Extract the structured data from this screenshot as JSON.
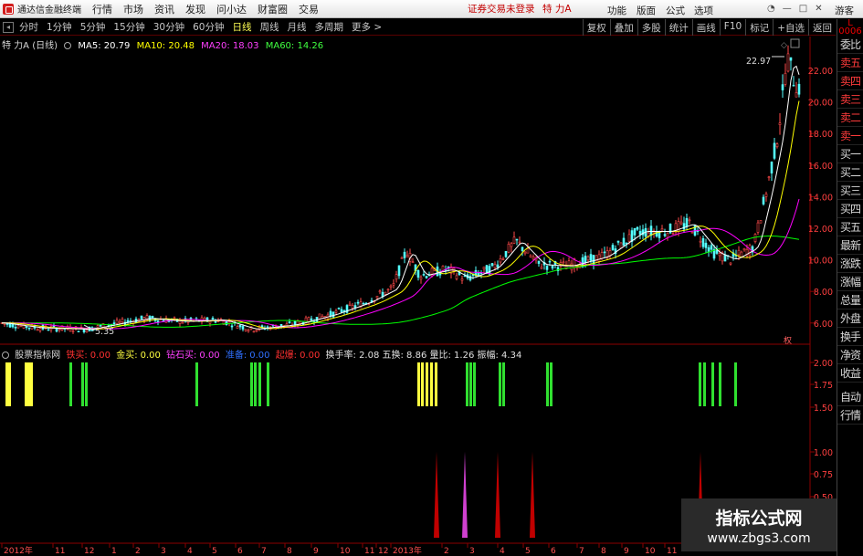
{
  "menubar": {
    "app_title": "通达信金融终端",
    "items": [
      "行情",
      "市场",
      "资讯",
      "发现",
      "问小达",
      "财富圈",
      "交易"
    ],
    "status_text": "证券交易未登录",
    "stock_name": "特 力A",
    "right_buttons": [
      "功能",
      "版面",
      "公式",
      "选项"
    ],
    "guest_label": "游客"
  },
  "toolbar": {
    "periods": [
      "分时",
      "1分钟",
      "5分钟",
      "15分钟",
      "30分钟",
      "60分钟",
      "日线",
      "周线",
      "月线",
      "多周期",
      "更多 >"
    ],
    "active_period": "日线",
    "right_tools": [
      "复权",
      "叠加",
      "多股",
      "统计",
      "画线",
      "F10",
      "标记",
      "+自选",
      "返回"
    ]
  },
  "chart_info": {
    "title": "特 力A (日线)",
    "ma5": "MA5: 20.79",
    "ma10": "MA10: 20.48",
    "ma20": "MA20: 18.03",
    "ma60": "MA60: 14.26"
  },
  "indicator_info": {
    "name": "股票指标网",
    "items": [
      {
        "label": "铁买:",
        "value": "0.00",
        "color": "#ff3030"
      },
      {
        "label": "金买:",
        "value": "0.00",
        "color": "#ffff40"
      },
      {
        "label": "钻石买:",
        "value": "0.00",
        "color": "#ff40ff"
      },
      {
        "label": "准备:",
        "value": "0.00",
        "color": "#3070ff"
      },
      {
        "label": "起爆:",
        "value": "0.00",
        "color": "#ff3030"
      }
    ],
    "stats": "换手率: 2.08  五换: 8.86  量比: 1.26  振幅: 4.34"
  },
  "right_panel": {
    "badge": "L 0006",
    "items": [
      "委比",
      "卖五",
      "卖四",
      "卖三",
      "卖二",
      "卖一",
      "买一",
      "买二",
      "买三",
      "买四",
      "买五",
      "最新",
      "涨跌",
      "涨幅",
      "总量",
      "外盘",
      "换手",
      "净资",
      "收益"
    ],
    "bottom_items": [
      "自动",
      "行情"
    ]
  },
  "price_axis": [
    "22.00",
    "20.00",
    "18.00",
    "16.00",
    "14.00",
    "12.00",
    "10.00",
    "8.00",
    "6.00"
  ],
  "indicator_axis": [
    "2.00",
    "1.75",
    "1.50",
    "1.00",
    "0.75",
    "0.50",
    "0.25"
  ],
  "date_axis": [
    "2012年",
    "11",
    "12",
    "1",
    "2",
    "3",
    "4",
    "5",
    "6",
    "7",
    "8",
    "9",
    "10",
    "11",
    "12",
    "2013年",
    "2",
    "3",
    "4",
    "5",
    "6",
    "7",
    "8",
    "9",
    "10",
    "11"
  ],
  "annotations": {
    "high": "22.97",
    "low": "5.35"
  },
  "watermark": {
    "title": "指标公式网",
    "url": "www.zbgs3.com"
  },
  "colors": {
    "ma5": "#ffffff",
    "ma10": "#ffff00",
    "ma20": "#ff00ff",
    "ma60": "#00ff00",
    "yellow_bar": "#ffff40",
    "green_bar": "#30e030",
    "red_spike": "#c00000",
    "magenta_spike": "#d040d0"
  }
}
